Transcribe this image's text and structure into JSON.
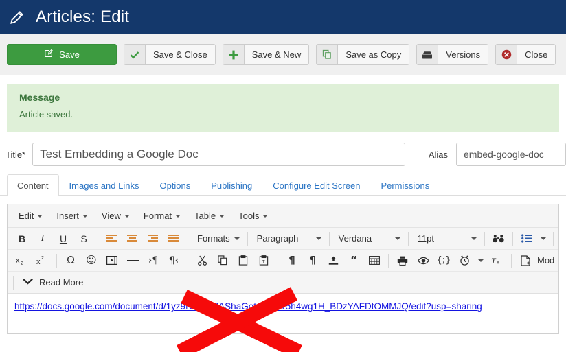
{
  "header": {
    "title": "Articles: Edit",
    "icon": "pencil-icon",
    "bg": "#14386b"
  },
  "toolbar": {
    "save_label": "Save",
    "save_close_label": "Save & Close",
    "save_new_label": "Save & New",
    "save_copy_label": "Save as Copy",
    "versions_label": "Versions",
    "close_label": "Close"
  },
  "message": {
    "title": "Message",
    "text": "Article saved.",
    "bg": "#dff0d8",
    "fg": "#3c763d"
  },
  "form": {
    "title_label": "Title",
    "title_required": "*",
    "title_value": "Test Embedding a Google Doc",
    "title_placeholder": "",
    "alias_label": "Alias",
    "alias_value": "embed-google-doc",
    "alias_placeholder": ""
  },
  "tabs": [
    {
      "label": "Content",
      "active": true
    },
    {
      "label": "Images and Links",
      "active": false
    },
    {
      "label": "Options",
      "active": false
    },
    {
      "label": "Publishing",
      "active": false
    },
    {
      "label": "Configure Edit Screen",
      "active": false
    },
    {
      "label": "Permissions",
      "active": false
    }
  ],
  "editor": {
    "menus": [
      "Edit",
      "Insert",
      "View",
      "Format",
      "Table",
      "Tools"
    ],
    "row1": {
      "formats_label": "Formats",
      "block_label": "Paragraph",
      "font_label": "Verdana",
      "size_label": "11pt"
    },
    "row3": {
      "readmore_label": "Read More"
    },
    "module_label": "Mod",
    "content_link": "https://docs.google.com/document/d/1yz9NJ5E_7AShaGotgUYY15h4wg1H_BDzYAFDtOMMJQ/edit?usp=sharing"
  },
  "annotation": {
    "shape": "red-x-mark",
    "color": "#f60a0a"
  }
}
